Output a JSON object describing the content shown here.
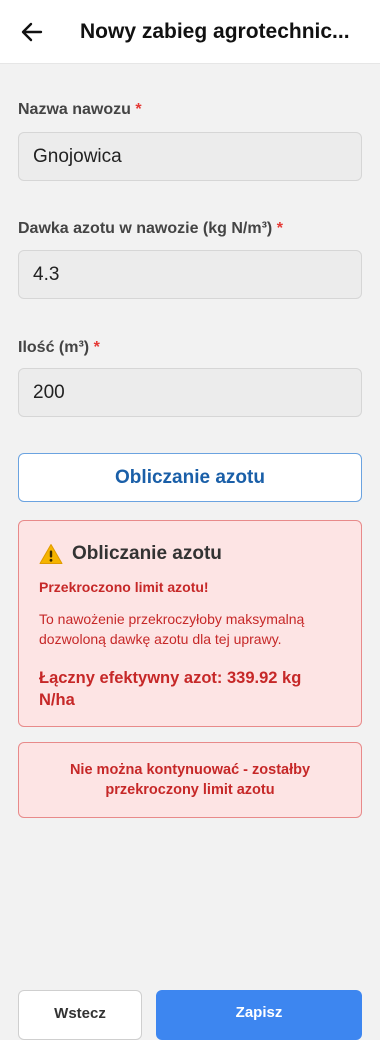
{
  "app_bar": {
    "title": "Nowy zabieg agrotechnic...",
    "back_icon": "arrow-left-icon"
  },
  "form": {
    "fertilizer_name": {
      "label": "Nazwa nawozu",
      "required_mark": "*",
      "value": "Gnojowica"
    },
    "nitrogen_dose": {
      "label": "Dawka azotu w nawozie (kg N/m³)",
      "required_mark": "*",
      "value": "4.3"
    },
    "quantity": {
      "label": "Ilość (m³)",
      "required_mark": "*",
      "value": "200"
    },
    "calc_button_label": "Obliczanie azotu"
  },
  "result_card": {
    "icon": "warning-icon",
    "title": "Obliczanie azotu",
    "alert": "Przekroczono limit azotu!",
    "description": "To nawożenie przekroczyłoby maksymalną dozwoloną dawkę azotu dla tej uprawy.",
    "total": "Łączny efektywny azot: 339.92 kg N/ha"
  },
  "blocked_message": "Nie można kontynuować - zostałby przekroczony limit azotu",
  "footer": {
    "back_label": "Wstecz",
    "save_label": "Zapisz"
  },
  "colors": {
    "accent": "#3d86f0",
    "error": "#c62828",
    "error_bg": "#fde4e4"
  }
}
